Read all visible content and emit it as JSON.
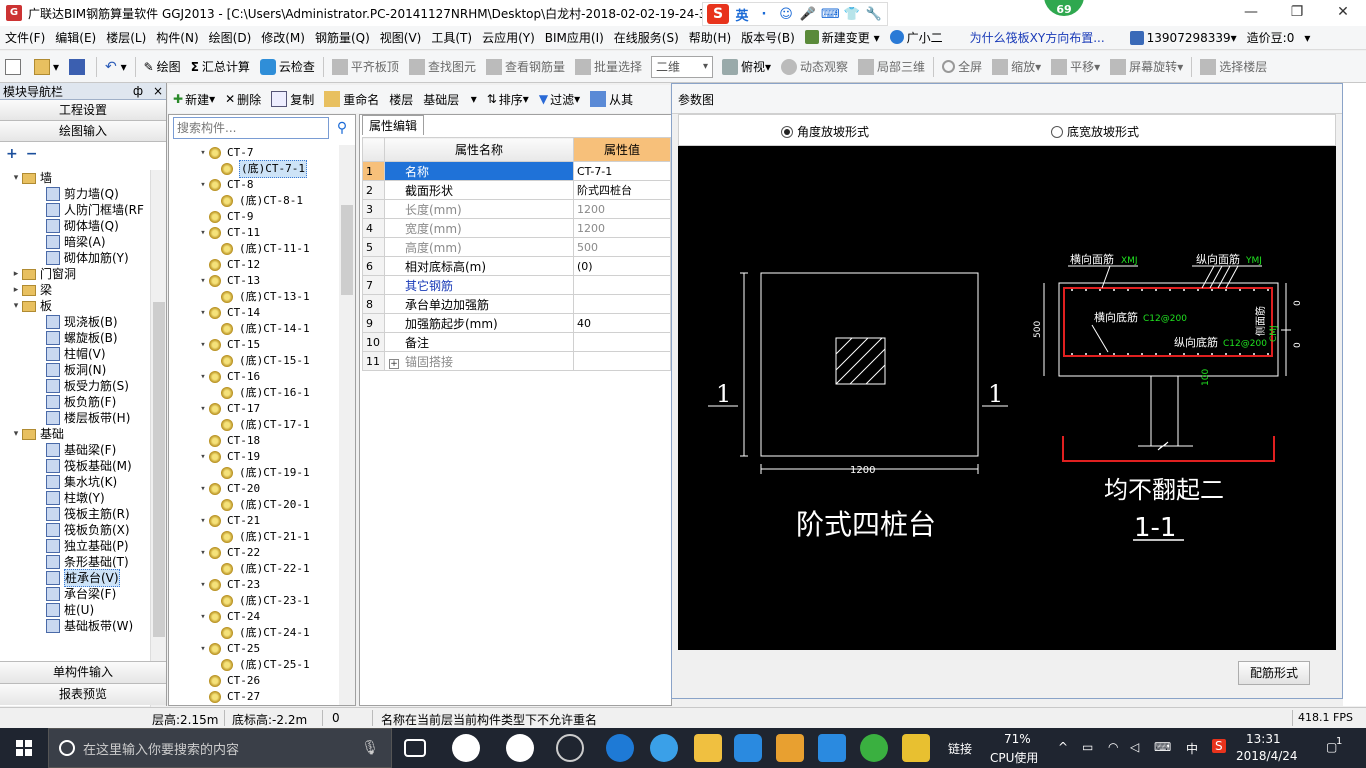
{
  "window": {
    "title": "广联达BIM钢筋算量软件 GGJ2013 - [C:\\Users\\Administrator.PC-20141127NRHM\\Desktop\\白龙村-2018-02-02-19-24-35",
    "ime_label": "英",
    "badge": "69"
  },
  "menu": {
    "items": [
      "文件(F)",
      "编辑(E)",
      "楼层(L)",
      "构件(N)",
      "绘图(D)",
      "修改(M)",
      "钢筋量(Q)",
      "视图(V)",
      "工具(T)",
      "云应用(Y)",
      "BIM应用(I)",
      "在线服务(S)",
      "帮助(H)",
      "版本号(B)"
    ],
    "new_change": "新建变更",
    "assistant": "广小二",
    "question": "为什么筏板XY方向布置...",
    "phone": "13907298339",
    "price": "造价豆:0"
  },
  "toolbar": {
    "draw": "绘图",
    "sum_calc": "汇总计算",
    "cloud_check": "云检查",
    "flat_top": "平齐板顶",
    "find_elem": "查找图元",
    "view_rebar": "查看钢筋量",
    "batch_select": "批量选择",
    "view_mode": "二维",
    "top_view": "俯视",
    "dynamic_view": "动态观察",
    "local_3d": "局部三维",
    "full_screen": "全屏",
    "zoom": "缩放",
    "pan": "平移",
    "rotate": "屏幕旋转",
    "select_floor": "选择楼层"
  },
  "nav": {
    "header": "模块导航栏",
    "pin": "ф",
    "close": "×",
    "project_settings": "工程设置",
    "draw_input": "绘图输入",
    "single_input": "单构件输入",
    "report_preview": "报表预览",
    "tree": [
      {
        "type": "folder",
        "label": "墙",
        "expanded": true
      },
      {
        "type": "leaf",
        "label": "剪力墙(Q)"
      },
      {
        "type": "leaf",
        "label": "人防门框墙(RF"
      },
      {
        "type": "leaf",
        "label": "砌体墙(Q)"
      },
      {
        "type": "leaf",
        "label": "暗梁(A)"
      },
      {
        "type": "leaf",
        "label": "砌体加筋(Y)"
      },
      {
        "type": "folder",
        "label": "门窗洞",
        "expanded": false
      },
      {
        "type": "folder",
        "label": "梁",
        "expanded": false
      },
      {
        "type": "folder",
        "label": "板",
        "expanded": true
      },
      {
        "type": "leaf",
        "label": "现浇板(B)"
      },
      {
        "type": "leaf",
        "label": "螺旋板(B)"
      },
      {
        "type": "leaf",
        "label": "柱帽(V)"
      },
      {
        "type": "leaf",
        "label": "板洞(N)"
      },
      {
        "type": "leaf",
        "label": "板受力筋(S)"
      },
      {
        "type": "leaf",
        "label": "板负筋(F)"
      },
      {
        "type": "leaf",
        "label": "楼层板带(H)"
      },
      {
        "type": "folder",
        "label": "基础",
        "expanded": true
      },
      {
        "type": "leaf",
        "label": "基础梁(F)"
      },
      {
        "type": "leaf",
        "label": "筏板基础(M)"
      },
      {
        "type": "leaf",
        "label": "集水坑(K)"
      },
      {
        "type": "leaf",
        "label": "柱墩(Y)"
      },
      {
        "type": "leaf",
        "label": "筏板主筋(R)"
      },
      {
        "type": "leaf",
        "label": "筏板负筋(X)"
      },
      {
        "type": "leaf",
        "label": "独立基础(P)"
      },
      {
        "type": "leaf",
        "label": "条形基础(T)"
      },
      {
        "type": "leaf",
        "label": "桩承台(V)",
        "selected": true
      },
      {
        "type": "leaf",
        "label": "承台梁(F)"
      },
      {
        "type": "leaf",
        "label": "桩(U)"
      },
      {
        "type": "leaf",
        "label": "基础板带(W)"
      }
    ]
  },
  "list_toolbar": {
    "new": "新建",
    "delete": "删除",
    "copy": "复制",
    "rename": "重命名",
    "floor_label": "楼层",
    "floor_value": "基础层",
    "sort": "排序",
    "filter": "过滤",
    "from_other": "从其"
  },
  "complist": {
    "search_placeholder": "搜索构件...",
    "items": [
      {
        "label": "CT-7",
        "level": 0,
        "expanded": true
      },
      {
        "label": "(底)CT-7-1",
        "level": 1,
        "selected": true
      },
      {
        "label": "CT-8",
        "level": 0,
        "expanded": true
      },
      {
        "label": "(底)CT-8-1",
        "level": 1
      },
      {
        "label": "CT-9",
        "level": 0
      },
      {
        "label": "CT-11",
        "level": 0,
        "expanded": true
      },
      {
        "label": "(底)CT-11-1",
        "level": 1
      },
      {
        "label": "CT-12",
        "level": 0
      },
      {
        "label": "CT-13",
        "level": 0,
        "expanded": true
      },
      {
        "label": "(底)CT-13-1",
        "level": 1
      },
      {
        "label": "CT-14",
        "level": 0,
        "expanded": true
      },
      {
        "label": "(底)CT-14-1",
        "level": 1
      },
      {
        "label": "CT-15",
        "level": 0,
        "expanded": true
      },
      {
        "label": "(底)CT-15-1",
        "level": 1
      },
      {
        "label": "CT-16",
        "level": 0,
        "expanded": true
      },
      {
        "label": "(底)CT-16-1",
        "level": 1
      },
      {
        "label": "CT-17",
        "level": 0,
        "expanded": true
      },
      {
        "label": "(底)CT-17-1",
        "level": 1
      },
      {
        "label": "CT-18",
        "level": 0
      },
      {
        "label": "CT-19",
        "level": 0,
        "expanded": true
      },
      {
        "label": "(底)CT-19-1",
        "level": 1
      },
      {
        "label": "CT-20",
        "level": 0,
        "expanded": true
      },
      {
        "label": "(底)CT-20-1",
        "level": 1
      },
      {
        "label": "CT-21",
        "level": 0,
        "expanded": true
      },
      {
        "label": "(底)CT-21-1",
        "level": 1
      },
      {
        "label": "CT-22",
        "level": 0,
        "expanded": true
      },
      {
        "label": "(底)CT-22-1",
        "level": 1
      },
      {
        "label": "CT-23",
        "level": 0,
        "expanded": true
      },
      {
        "label": "(底)CT-23-1",
        "level": 1
      },
      {
        "label": "CT-24",
        "level": 0,
        "expanded": true
      },
      {
        "label": "(底)CT-24-1",
        "level": 1
      },
      {
        "label": "CT-25",
        "level": 0,
        "expanded": true
      },
      {
        "label": "(底)CT-25-1",
        "level": 1
      },
      {
        "label": "CT-26",
        "level": 0
      },
      {
        "label": "CT-27",
        "level": 0
      }
    ]
  },
  "props": {
    "tab": "属性编辑",
    "col_name": "属性名称",
    "col_value": "属性值",
    "rows": [
      {
        "idx": "1",
        "name": "名称",
        "value": "CT-7-1",
        "style": "blue",
        "selected": true
      },
      {
        "idx": "2",
        "name": "截面形状",
        "value": "阶式四桩台",
        "style": "normal"
      },
      {
        "idx": "3",
        "name": "长度(mm)",
        "value": "1200",
        "style": "gray"
      },
      {
        "idx": "4",
        "name": "宽度(mm)",
        "value": "1200",
        "style": "gray"
      },
      {
        "idx": "5",
        "name": "高度(mm)",
        "value": "500",
        "style": "gray"
      },
      {
        "idx": "6",
        "name": "相对底标高(m)",
        "value": "(0)",
        "style": "normal"
      },
      {
        "idx": "7",
        "name": "其它钢筋",
        "value": "",
        "style": "blue"
      },
      {
        "idx": "8",
        "name": "承台单边加强筋",
        "value": "",
        "style": "normal"
      },
      {
        "idx": "9",
        "name": "加强筋起步(mm)",
        "value": "40",
        "style": "normal"
      },
      {
        "idx": "10",
        "name": "备注",
        "value": "",
        "style": "normal"
      },
      {
        "idx": "11",
        "name": "锚固搭接",
        "value": "",
        "style": "gray",
        "expandable": true
      }
    ]
  },
  "param": {
    "title": "参数图",
    "radio_angle": "角度放坡形式",
    "radio_width": "底宽放坡形式",
    "button": "配筋形式",
    "drawing": {
      "plan_title": "阶式四桩台",
      "plan_dim": "1200",
      "section_mark_left": "1",
      "section_mark_right": "1",
      "top_x_label": "横向面筋",
      "top_x_code": "XMJ",
      "top_y_label": "纵向面筋",
      "top_y_code": "YMJ",
      "bot_x_label": "横向底筋",
      "bot_x_code": "C12@200",
      "bot_y_label": "纵向底筋",
      "bot_y_code": "C12@200",
      "side_label": "侧面筋",
      "side_code": "CMJ",
      "height_dim": "500",
      "dim_zero_top": "0",
      "dim_zero_bot": "0",
      "pile_dim": "100",
      "section_note": "均不翻起二",
      "section_title": "1-1"
    }
  },
  "status": {
    "floor_height": "层高:2.15m",
    "bottom_elev": "底标高:-2.2m",
    "zero": "0",
    "message": "名称在当前层当前构件类型下不允许重名",
    "fps": "418.1 FPS"
  },
  "taskbar": {
    "search_placeholder": "在这里输入你要搜索的内容",
    "link": "链接",
    "cpu_percent": "71%",
    "cpu_label": "CPU使用",
    "lang": "中",
    "time": "13:31",
    "date": "2018/4/24",
    "notify_count": "1"
  }
}
